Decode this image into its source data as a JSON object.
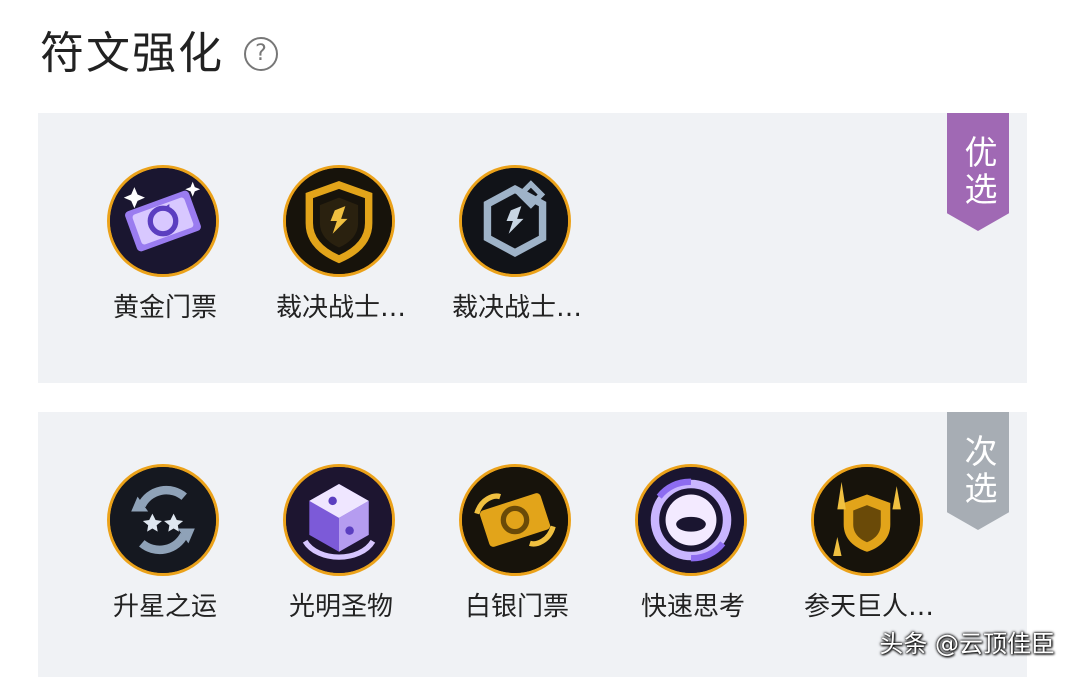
{
  "header": {
    "title": "符文强化",
    "help": "?"
  },
  "sections": [
    {
      "ribbon": "优选",
      "items": [
        {
          "label": "黄金门票",
          "icon": "golden-ticket-icon"
        },
        {
          "label": "裁决战士…",
          "icon": "gold-shield-icon"
        },
        {
          "label": "裁决战士…",
          "icon": "silver-shield-icon"
        }
      ]
    },
    {
      "ribbon": "次选",
      "items": [
        {
          "label": "升星之运",
          "icon": "star-luck-icon"
        },
        {
          "label": "光明圣物",
          "icon": "holy-relic-icon"
        },
        {
          "label": "白银门票",
          "icon": "silver-ticket-icon"
        },
        {
          "label": "快速思考",
          "icon": "quick-think-icon"
        },
        {
          "label": "参天巨人…",
          "icon": "titan-icon"
        }
      ]
    }
  ],
  "watermark": "头条 @云顶佳臣",
  "colors": {
    "ribbon_primary": "#a069b4",
    "ribbon_secondary": "#a7adb4",
    "icon_border": "#eba21a",
    "panel_bg": "#f0f2f5"
  }
}
